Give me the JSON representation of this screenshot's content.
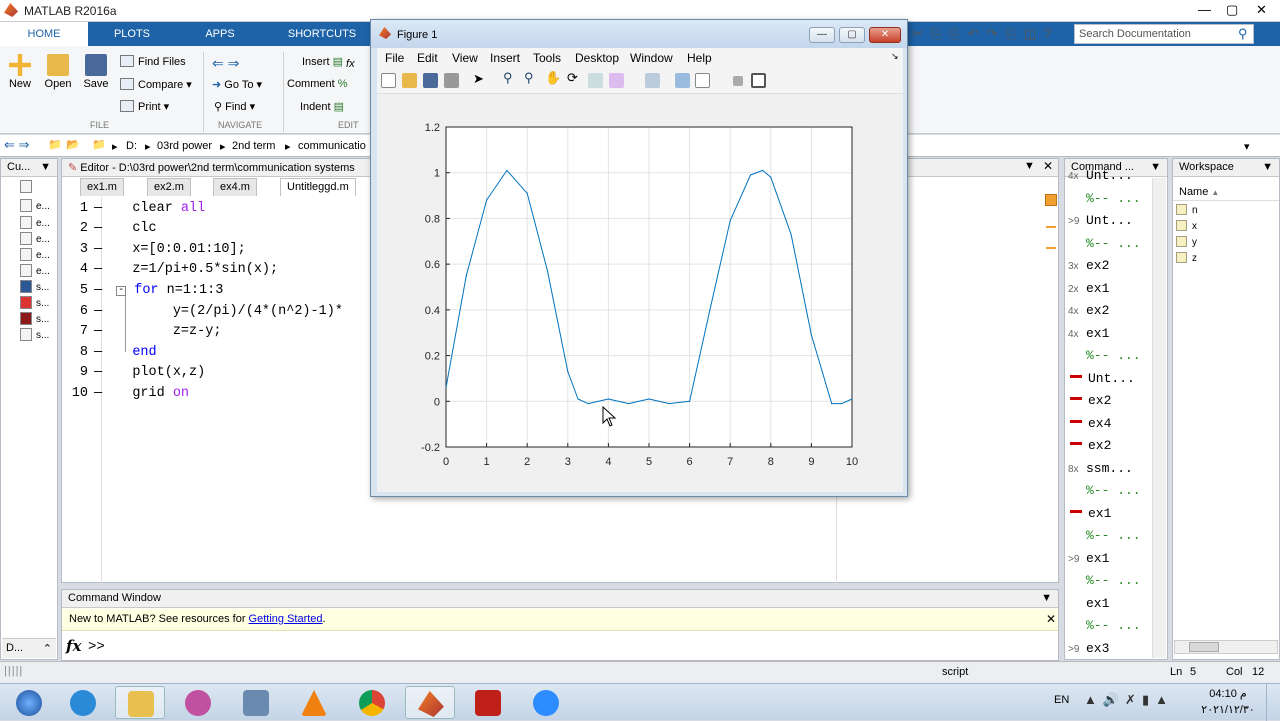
{
  "app": {
    "title": "MATLAB R2016a"
  },
  "tabs": [
    "HOME",
    "PLOTS",
    "APPS",
    "SHORTCUTS"
  ],
  "ribbon": {
    "file": {
      "new": "New",
      "open": "Open",
      "save": "Save",
      "find_files": "Find Files",
      "compare": "Compare",
      "print": "Print"
    },
    "navigate": {
      "go_to": "Go To",
      "find": "Find"
    },
    "edit": {
      "insert": "Insert",
      "comment": "Comment",
      "indent": "Indent"
    },
    "groups": {
      "file": "FILE",
      "navigate": "NAVIGATE",
      "edit": "EDIT"
    }
  },
  "search": {
    "placeholder": "Search Documentation"
  },
  "address": {
    "crumbs": [
      "D:",
      "03rd power",
      "2nd term",
      "communicatio"
    ]
  },
  "current_folder": {
    "header": "Cu...",
    "files": [
      "e...",
      "e...",
      "e...",
      "e...",
      "e...",
      "s...",
      "s...",
      "s...",
      "s..."
    ],
    "bottom_label": "D..."
  },
  "editor": {
    "title": "Editor - D:\\03rd power\\2nd term\\communication systems",
    "tabs": [
      "ex1.m",
      "ex2.m",
      "ex4.m",
      "Untitleggd.m"
    ],
    "lines": [
      {
        "n": "1",
        "code": "clear ",
        "kw": "all"
      },
      {
        "n": "2",
        "code": "clc"
      },
      {
        "n": "3",
        "code": "x=[0:0.01:10];"
      },
      {
        "n": "4",
        "code": "z=1/pi+0.5*sin(x);"
      },
      {
        "n": "5",
        "kw_blue": "for",
        "code": " n=1:1:3"
      },
      {
        "n": "6",
        "code": "y=(2/pi)/(4*(n^2)-1)*"
      },
      {
        "n": "7",
        "code": "z=z-y;"
      },
      {
        "n": "8",
        "kw_blue": "end"
      },
      {
        "n": "9",
        "code": "plot(x,z)"
      },
      {
        "n": "10",
        "code": "grid ",
        "kw": "on"
      }
    ]
  },
  "command_window": {
    "header": "Command Window",
    "banner_text": "New to MATLAB? See resources for ",
    "banner_link": "Getting Started",
    "banner_end": ".",
    "prompt": ">>",
    "fx": "fx"
  },
  "history": {
    "header": "Command ...",
    "items": [
      {
        "pre": "4x",
        "text": "Unt..."
      },
      {
        "pre": "",
        "text": "%-- ...",
        "green": true
      },
      {
        "pre": ">9",
        "text": "Unt..."
      },
      {
        "pre": "",
        "text": "%-- ...",
        "green": true
      },
      {
        "pre": "3x",
        "text": "ex2"
      },
      {
        "pre": "2x",
        "text": "ex1"
      },
      {
        "pre": "4x",
        "text": "ex2"
      },
      {
        "pre": "4x",
        "text": "ex1"
      },
      {
        "pre": "",
        "text": "%-- ...",
        "green": true
      },
      {
        "pre": "red",
        "text": "Unt..."
      },
      {
        "pre": "red",
        "text": "ex2"
      },
      {
        "pre": "red",
        "text": "ex4"
      },
      {
        "pre": "red",
        "text": "ex2"
      },
      {
        "pre": "8x",
        "text": "ssm..."
      },
      {
        "pre": "",
        "text": "%-- ...",
        "green": true
      },
      {
        "pre": "red",
        "text": "ex1"
      },
      {
        "pre": "",
        "text": "%-- ...",
        "green": true
      },
      {
        "pre": ">9",
        "text": "ex1"
      },
      {
        "pre": "",
        "text": "%-- ...",
        "green": true
      },
      {
        "pre": "",
        "text": "ex1"
      },
      {
        "pre": "",
        "text": "%-- ...",
        "green": true
      },
      {
        "pre": ">9",
        "text": "ex3"
      }
    ]
  },
  "workspace": {
    "header": "Workspace",
    "col_name": "Name",
    "vars": [
      "n",
      "x",
      "y",
      "z"
    ]
  },
  "status": {
    "mode": "script",
    "ln_label": "Ln",
    "ln": "5",
    "col_label": "Col",
    "col": "12"
  },
  "figure": {
    "title": "Figure 1",
    "menu": [
      "File",
      "Edit",
      "View",
      "Insert",
      "Tools",
      "Desktop",
      "Window",
      "Help"
    ]
  },
  "chart_data": {
    "type": "line",
    "title": "",
    "xlabel": "",
    "ylabel": "",
    "xlim": [
      0,
      10
    ],
    "ylim": [
      -0.2,
      1.2
    ],
    "xticks": [
      0,
      1,
      2,
      3,
      4,
      5,
      6,
      7,
      8,
      9,
      10
    ],
    "yticks": [
      -0.2,
      0,
      0.2,
      0.4,
      0.6,
      0.8,
      1,
      1.2
    ],
    "grid": true,
    "series": [
      {
        "x": [
          0,
          0.5,
          1,
          1.5,
          2,
          2.5,
          3,
          3.25,
          3.5,
          4,
          4.5,
          5,
          5.5,
          6,
          6.5,
          7,
          7.5,
          7.8,
          8,
          8.5,
          9,
          9.5,
          9.75,
          10
        ],
        "y": [
          0.06,
          0.55,
          0.88,
          1.01,
          0.91,
          0.57,
          0.13,
          0.01,
          -0.01,
          0.01,
          -0.01,
          0.01,
          -0.01,
          0.0,
          0.4,
          0.79,
          0.99,
          1.01,
          0.98,
          0.73,
          0.29,
          -0.01,
          -0.01,
          0.01
        ]
      }
    ]
  },
  "taskbar": {
    "lang": "EN",
    "time": "04:10 م",
    "date": "٢٠٢١/١٢/٣٠"
  }
}
